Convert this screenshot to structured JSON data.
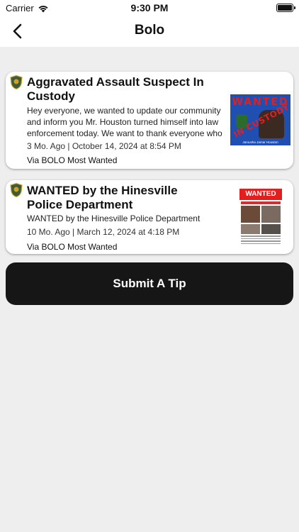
{
  "status_bar": {
    "carrier": "Carrier",
    "time": "9:30 PM"
  },
  "nav": {
    "title": "Bolo",
    "back_icon": "chevron-left-icon"
  },
  "posts": [
    {
      "title": "Aggravated Assault Suspect In Custody",
      "body": "Hey everyone, we wanted to update our community and inform you Mr. Houston turned himself into law enforcement today. We want to thank everyone who s...",
      "meta": "3 Mo. Ago | October 14, 2024 at 8:54 PM",
      "source": "Via BOLO Most Wanted",
      "badge_icon": "police-badge-icon",
      "thumbnail": {
        "heading": "WANTED",
        "stamp": "IN CUSTODY",
        "caption": "Jarousha Jamar Houston"
      }
    },
    {
      "title": "WANTED by the Hinesville Police Department",
      "body": "WANTED by the Hinesville Police Department",
      "meta": "10 Mo. Ago | March 12, 2024 at 4:18 PM",
      "source": "Via BOLO Most Wanted",
      "badge_icon": "police-badge-icon",
      "thumbnail": {
        "heading": "WANTED"
      }
    }
  ],
  "actions": {
    "submit_tip": "Submit A Tip"
  },
  "colors": {
    "background": "#eeeeee",
    "card": "#ffffff",
    "button": "#161616",
    "wanted_red": "#e02020"
  }
}
